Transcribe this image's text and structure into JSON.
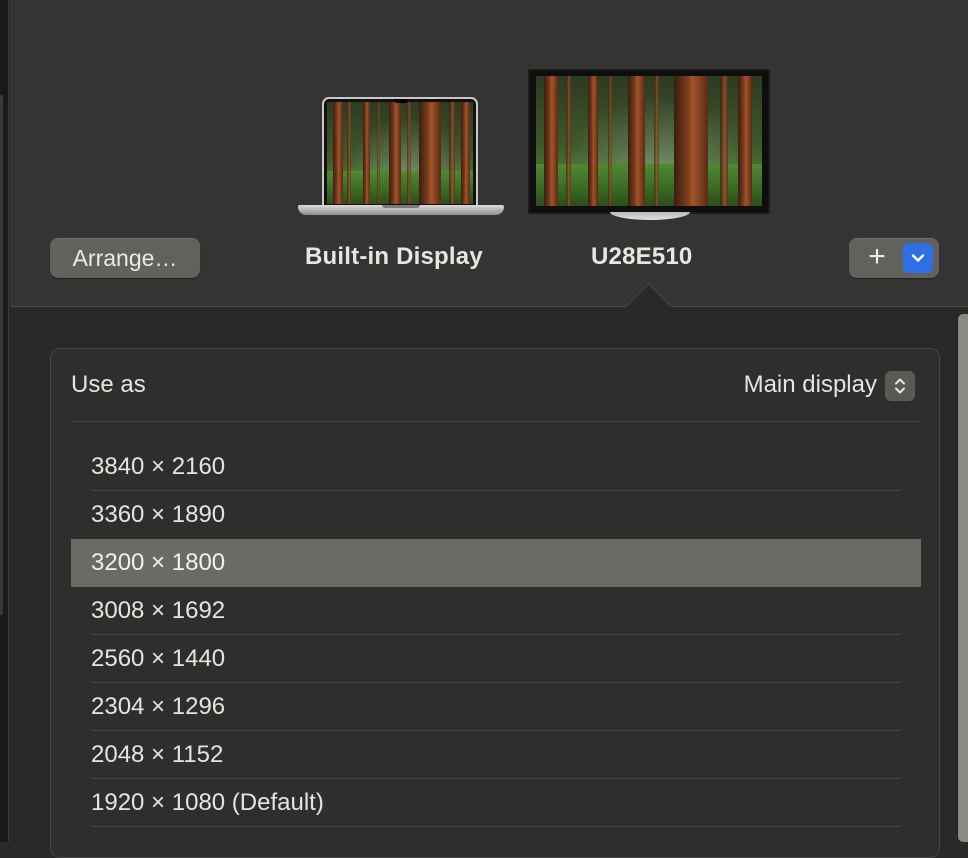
{
  "displays": [
    {
      "name": "Built-in Display",
      "kind": "laptop",
      "selected": false
    },
    {
      "name": "U28E510",
      "kind": "external-monitor",
      "selected": true
    }
  ],
  "toolbar": {
    "arrange_label": "Arrange…",
    "add_label": "+"
  },
  "panel": {
    "use_as_label": "Use as",
    "use_as_value": "Main display",
    "resolutions": [
      "3840 × 2160",
      "3360 × 1890",
      "3200 × 1800",
      "3008 × 1692",
      "2560 × 1440",
      "2304 × 1296",
      "2048 × 1152",
      "1920 × 1080 (Default)"
    ],
    "selected_resolution": "3200 × 1800"
  },
  "icons": {
    "add": "plus-icon",
    "menu": "chevron-down-icon",
    "stepper": "up-down-chevron-icon"
  },
  "colors": {
    "background": "#2a2927",
    "arrangement_background": "#353432",
    "accent": "#2f6fe6",
    "selected_row": "#6b6a67"
  }
}
